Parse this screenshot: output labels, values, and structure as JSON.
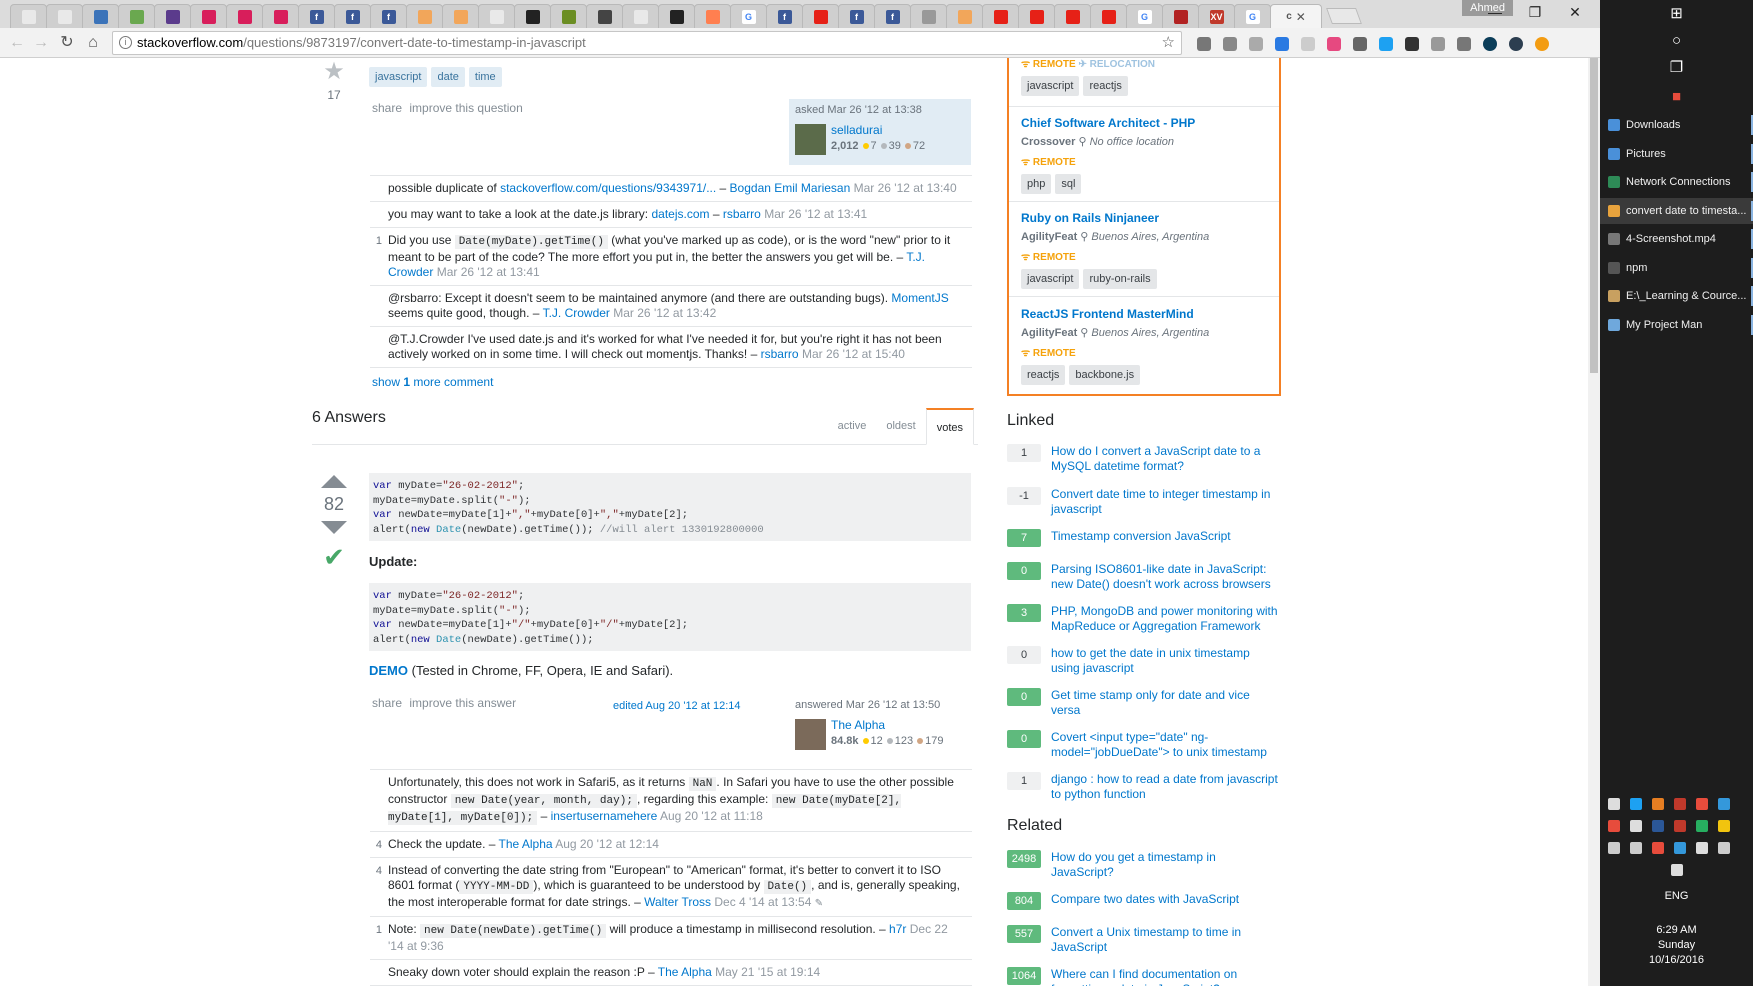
{
  "browser": {
    "tabs": [
      {
        "label": "",
        "color": "#e9e9e9"
      },
      {
        "label": "",
        "color": "#e9e9e9"
      },
      {
        "label": "",
        "color": "#3b73b9"
      },
      {
        "label": "",
        "color": "#6aa84f"
      },
      {
        "label": "",
        "color": "#5b3b8c"
      },
      {
        "label": "",
        "color": "#d81e5b"
      },
      {
        "label": "",
        "color": "#d81e5b"
      },
      {
        "label": "",
        "color": "#d81e5b"
      },
      {
        "label": "f",
        "color": "#3b5998"
      },
      {
        "label": "f",
        "color": "#3b5998"
      },
      {
        "label": "f",
        "color": "#3b5998"
      },
      {
        "label": "",
        "color": "#f2a65a"
      },
      {
        "label": "",
        "color": "#f2a65a"
      },
      {
        "label": "",
        "color": "#e9e9e9"
      },
      {
        "label": "",
        "color": "#222222"
      },
      {
        "label": "",
        "color": "#6b8e23"
      },
      {
        "label": "",
        "color": "#444444"
      },
      {
        "label": "",
        "color": "#e9e9e9"
      },
      {
        "label": "",
        "color": "#222222"
      },
      {
        "label": "",
        "color": "#ff7f50"
      },
      {
        "label": "G",
        "color": "#ffffff"
      },
      {
        "label": "f",
        "color": "#3b5998"
      },
      {
        "label": "",
        "color": "#e62117"
      },
      {
        "label": "f",
        "color": "#3b5998"
      },
      {
        "label": "f",
        "color": "#3b5998"
      },
      {
        "label": "",
        "color": "#999999"
      },
      {
        "label": "",
        "color": "#f2a65a"
      },
      {
        "label": "",
        "color": "#e62117"
      },
      {
        "label": "",
        "color": "#e62117"
      },
      {
        "label": "",
        "color": "#e62117"
      },
      {
        "label": "",
        "color": "#e62117"
      },
      {
        "label": "G",
        "color": "#ffffff"
      },
      {
        "label": "",
        "color": "#b22222"
      },
      {
        "label": "XV",
        "color": "#c0392b"
      },
      {
        "label": "G",
        "color": "#ffffff"
      }
    ],
    "active_tab_label": "c",
    "active_tab_close": "✕",
    "user_badge": "Ahmed",
    "url_host": "stackoverflow.com",
    "url_path": "/questions/9873197/convert-date-to-timestamp-in-javascript",
    "ext_colors": [
      "#777777",
      "#888888",
      "#aaaaaa",
      "#2a7ae2",
      "#cccccc",
      "#e64980",
      "#666666",
      "#1da1f2",
      "#333333",
      "#999999",
      "#777777",
      "#0b3d59",
      "#2c3e50",
      "#f39c12"
    ]
  },
  "question": {
    "favorite_count": "17",
    "tags": [
      "javascript",
      "date",
      "time"
    ],
    "share_links": [
      "share",
      "improve this question"
    ],
    "asked_label": "asked Mar 26 '12 at 13:38",
    "asker_name": "selladurai",
    "asker_rep": "2,012",
    "asker_gold": "7",
    "asker_silver": "39",
    "asker_bronze": "72",
    "comments": [
      {
        "score": "",
        "parts": [
          "possible duplicate of "
        ],
        "link1": "stackoverflow.com/questions/9343971/...",
        "sep": " – ",
        "user": "Bogdan Emil Mariesan",
        "date": " Mar 26 '12 at 13:40"
      },
      {
        "score": "",
        "parts": [
          "you may want to take a look at the date.js library: "
        ],
        "link1": "datejs.com",
        "sep": " – ",
        "user": "rsbarro",
        "date": " Mar 26 '12 at 13:41"
      }
    ],
    "c3_score": "1",
    "c3_a": "Did you use ",
    "c3_code": "Date(myDate).getTime()",
    "c3_b": " (what you've marked up as code), or is the word \"new\" prior to it meant to be part of the code? The more effort you put in, the better the answers you get will be. – ",
    "c3_user": "T.J. Crowder",
    "c3_date": " Mar 26 '12 at 13:41",
    "c4_a": "@rsbarro: Except it doesn't seem to be maintained anymore (and there are outstanding bugs). ",
    "c4_link": "MomentJS",
    "c4_b": " seems quite good, though. – ",
    "c4_user": "T.J. Crowder",
    "c4_date": " Mar 26 '12 at 13:42",
    "c5_a": "@T.J.Crowder I've used date.js and it's worked for what I've needed it for, but you're right it has not been actively worked on in some time. I will check out momentjs. Thanks! – ",
    "c5_user": "rsbarro",
    "c5_date": " Mar 26 '12 at 15:40",
    "show_more_a": "show ",
    "show_more_n": "1",
    "show_more_b": " more comment"
  },
  "answers": {
    "count_label": "6 Answers",
    "sort_tabs": [
      "active",
      "oldest",
      "votes"
    ],
    "vote_count": "82",
    "update_heading": "Update:",
    "demo_link": "DEMO",
    "demo_text": " (Tested in Chrome, FF, Opera, IE and Safari).",
    "share_links": [
      "share",
      "improve this answer"
    ],
    "edited_label": "edited Aug 20 '12 at 12:14",
    "answered_label": "answered Mar 26 '12 at 13:50",
    "answerer_name": "The Alpha",
    "answerer_rep": "84.8k",
    "answerer_gold": "12",
    "answerer_silver": "123",
    "answerer_bronze": "179",
    "code1": [
      {
        "t": "var myDate=",
        "k": "kw0"
      },
      {
        "t": "\"26-02-2012\"",
        "k": "str"
      },
      {
        "t": ";\nmyDate=myDate.split(",
        "k": "p"
      },
      {
        "t": "\"-\"",
        "k": "str"
      },
      {
        "t": ");\n",
        "k": "p"
      },
      {
        "t": "var",
        "k": "kw"
      },
      {
        "t": " newDate=myDate[1]+",
        "k": "p"
      },
      {
        "t": "\",\"",
        "k": "str"
      },
      {
        "t": "+myDate[0]+",
        "k": "p"
      },
      {
        "t": "\",\"",
        "k": "str"
      },
      {
        "t": "+myDate[2];\nalert(",
        "k": "p"
      },
      {
        "t": "new",
        "k": "kw"
      },
      {
        "t": " ",
        "k": "p"
      },
      {
        "t": "Date",
        "k": "ty"
      },
      {
        "t": "(newDate).getTime()); ",
        "k": "p"
      },
      {
        "t": "//will alert 1330192800000",
        "k": "cm"
      }
    ],
    "code2": [
      {
        "t": "var myDate=",
        "k": "kw0"
      },
      {
        "t": "\"26-02-2012\"",
        "k": "str"
      },
      {
        "t": ";\nmyDate=myDate.split(",
        "k": "p"
      },
      {
        "t": "\"-\"",
        "k": "str"
      },
      {
        "t": ");\n",
        "k": "p"
      },
      {
        "t": "var",
        "k": "kw"
      },
      {
        "t": " newDate=myDate[1]+",
        "k": "p"
      },
      {
        "t": "\"/\"",
        "k": "str"
      },
      {
        "t": "+myDate[0]+",
        "k": "p"
      },
      {
        "t": "\"/\"",
        "k": "str"
      },
      {
        "t": "+myDate[2];\nalert(",
        "k": "p"
      },
      {
        "t": "new",
        "k": "kw"
      },
      {
        "t": " ",
        "k": "p"
      },
      {
        "t": "Date",
        "k": "ty"
      },
      {
        "t": "(newDate).getTime());",
        "k": "p"
      }
    ],
    "ac1_a": "Unfortunately, this does not work in Safari5, as it returns ",
    "ac1_c1": "NaN",
    "ac1_b": ". In Safari you have to use the other possible constructor ",
    "ac1_c2": "new Date(year, month, day);",
    "ac1_c": ", regarding this example: ",
    "ac1_c3": "new Date(myDate[2], myDate[1], myDate[0]);",
    "ac1_d": " – ",
    "ac1_user": "insertusernamehere",
    "ac1_date": " Aug 20 '12 at 11:18",
    "ac2_score": "4",
    "ac2_a": "Check the update. – ",
    "ac2_user": "The Alpha",
    "ac2_date": " Aug 20 '12 at 12:14",
    "ac3_score": "4",
    "ac3_a": "Instead of converting the date string from \"European\" to \"American\" format, it's better to convert it to ISO 8601 format (",
    "ac3_c1": "YYYY-MM-DD",
    "ac3_b": "), which is guaranteed to be understood by ",
    "ac3_c2": "Date()",
    "ac3_c": ", and is, generally speaking, the most interoperable format for date strings. – ",
    "ac3_user": "Walter Tross",
    "ac3_date": " Dec 4 '14 at 13:54",
    "ac3_edit": "✎",
    "ac4_score": "1",
    "ac4_a": "Note: ",
    "ac4_c1": "new Date(newDate).getTime()",
    "ac4_b": " will produce a timestamp in millisecond resolution. – ",
    "ac4_user": "h7r",
    "ac4_date": " Dec 22 '14 at 9:36",
    "ac5_a": "Sneaky down voter should explain the reason :P – ",
    "ac5_user": "The Alpha",
    "ac5_date": " May 21 '15 at 19:14"
  },
  "jobs": {
    "top_remote": "REMOTE",
    "top_relocation": "RELOCATION",
    "top_tags": [
      "javascript",
      "reactjs"
    ],
    "items": [
      {
        "title": "Chief Software Architect - PHP",
        "company": "Crossover",
        "location": "No office location",
        "remote": "REMOTE",
        "tags": [
          "php",
          "sql"
        ]
      },
      {
        "title": "Ruby on Rails Ninjaneer",
        "company": "AgilityFeat",
        "location": "Buenos Aires, Argentina",
        "remote": "REMOTE",
        "tags": [
          "javascript",
          "ruby-on-rails"
        ]
      },
      {
        "title": "ReactJS Frontend MasterMind",
        "company": "AgilityFeat",
        "location": "Buenos Aires, Argentina",
        "remote": "REMOTE",
        "tags": [
          "reactjs",
          "backbone.js"
        ]
      }
    ]
  },
  "linked": {
    "heading": "Linked",
    "items": [
      {
        "score": "1",
        "answered": false,
        "title": "How do I convert a JavaScript date to a MySQL datetime format?"
      },
      {
        "score": "-1",
        "answered": false,
        "title": "Convert date time to integer timestamp in javascript"
      },
      {
        "score": "7",
        "answered": true,
        "title": "Timestamp conversion JavaScript"
      },
      {
        "score": "0",
        "answered": true,
        "title": "Parsing ISO8601-like date in JavaScript: new Date() doesn't work across browsers"
      },
      {
        "score": "3",
        "answered": true,
        "title": "PHP, MongoDB and power monitoring with MapReduce or Aggregation Framework"
      },
      {
        "score": "0",
        "answered": false,
        "title": "how to get the date in unix timestamp using javascript"
      },
      {
        "score": "0",
        "answered": true,
        "title": "Get time stamp only for date and vice versa"
      },
      {
        "score": "0",
        "answered": true,
        "title": "Covert <input type=\"date\" ng-model=\"jobDueDate\"> to unix timestamp"
      },
      {
        "score": "1",
        "answered": false,
        "title": "django : how to read a date from javascript to python function"
      }
    ]
  },
  "related": {
    "heading": "Related",
    "items": [
      {
        "score": "2498",
        "answered": true,
        "title": "How do you get a timestamp in JavaScript?"
      },
      {
        "score": "804",
        "answered": true,
        "title": "Compare two dates with JavaScript"
      },
      {
        "score": "557",
        "answered": true,
        "title": "Convert a Unix timestamp to time in JavaScript"
      },
      {
        "score": "1064",
        "answered": true,
        "title": "Where can I find documentation on formatting a date in JavaScript?"
      }
    ]
  },
  "taskbar": {
    "items": [
      {
        "label": "Downloads",
        "color": "#4a90d9",
        "active": false
      },
      {
        "label": "Pictures",
        "color": "#4a90d9",
        "active": false
      },
      {
        "label": "Network Connections",
        "color": "#2e8b57",
        "active": false
      },
      {
        "label": "convert date to timesta...",
        "color": "#e8a33d",
        "active": true
      },
      {
        "label": "4-Screenshot.mp4",
        "color": "#777777",
        "active": false
      },
      {
        "label": "npm",
        "color": "#555555",
        "active": false
      },
      {
        "label": "E:\\_Learning & Cource...",
        "color": "#c8a060",
        "active": false
      },
      {
        "label": "My Project Man",
        "color": "#6fa8dc",
        "active": false
      }
    ],
    "language": "ENG",
    "time": "6:29 AM",
    "day": "Sunday",
    "date": "10/16/2016"
  }
}
